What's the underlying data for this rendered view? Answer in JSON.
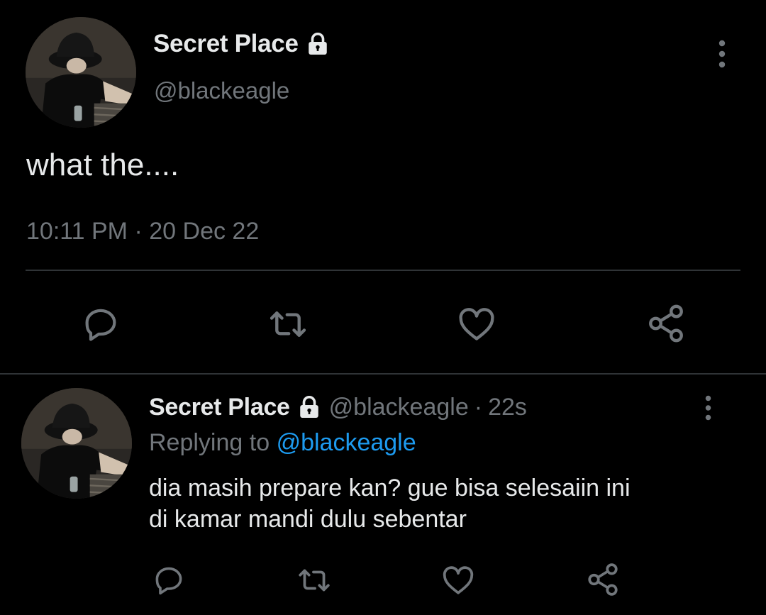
{
  "main_tweet": {
    "display_name": "Secret Place",
    "handle": "@blackeagle",
    "text": "what the....",
    "time": "10:11 PM",
    "separator": "·",
    "date": "20 Dec 22",
    "icons": {
      "more": "more-vertical-icon",
      "protected": "lock-icon",
      "reply": "reply-icon",
      "retweet": "retweet-icon",
      "like": "heart-icon",
      "share": "share-icon"
    }
  },
  "reply_tweet": {
    "display_name": "Secret Place",
    "handle": "@blackeagle",
    "separator": "·",
    "age": "22s",
    "replying_to_label": "Replying to",
    "replying_to_handle": "@blackeagle",
    "text_line1": "dia masih prepare kan? gue bisa selesaiin ini",
    "text_line2": "di kamar mandi dulu sebentar"
  },
  "colors": {
    "background": "#000000",
    "text": "#e7e9ea",
    "muted": "#71767b",
    "link": "#1d9bf0",
    "divider": "#2f3336"
  }
}
